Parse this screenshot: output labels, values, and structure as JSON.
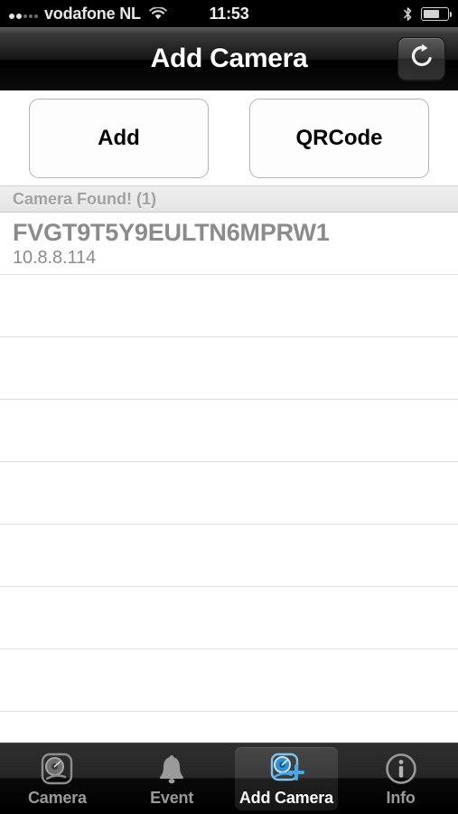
{
  "statusbar": {
    "carrier": "vodafone NL",
    "time": "11:53",
    "signal_icon": "signal-bars-icon",
    "wifi_icon": "wifi-icon",
    "bluetooth_icon": "bluetooth-icon",
    "battery_icon": "battery-icon"
  },
  "navbar": {
    "title": "Add Camera",
    "refresh_icon": "refresh-icon"
  },
  "actions": {
    "add_label": "Add",
    "qrcode_label": "QRCode"
  },
  "section": {
    "header": "Camera Found! (1)"
  },
  "list": {
    "items": [
      {
        "title": "FVGT9T5Y9EULTN6MPRW1",
        "subtitle": "10.8.8.114"
      }
    ],
    "empty_row_count": 7
  },
  "tabbar": {
    "tabs": [
      {
        "label": "Camera",
        "icon": "webcam-icon",
        "selected": false
      },
      {
        "label": "Event",
        "icon": "bell-icon",
        "selected": false
      },
      {
        "label": "Add Camera",
        "icon": "add-camera-icon",
        "selected": true
      },
      {
        "label": "Info",
        "icon": "info-circle-icon",
        "selected": false
      }
    ]
  },
  "colors": {
    "accent": "#4aa8e8",
    "navbar_bg": "#000000",
    "section_text": "#a0a0a0",
    "row_text": "#8b8b8b"
  }
}
